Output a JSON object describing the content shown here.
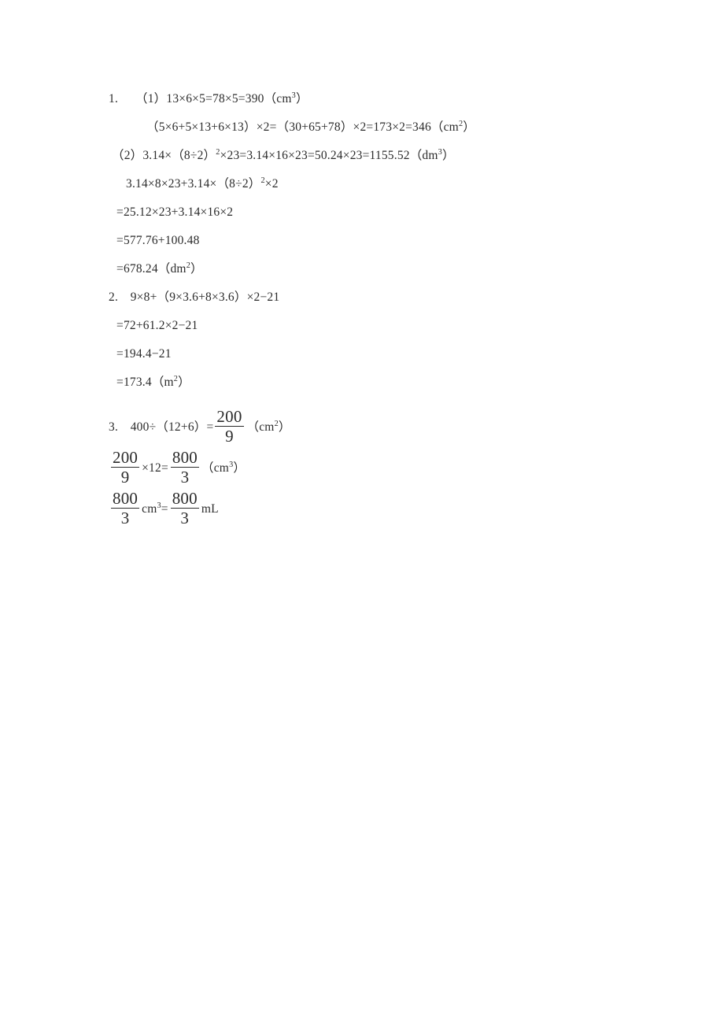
{
  "document": {
    "type": "math-answer-key",
    "text_color": "#2b2b2b",
    "background_color": "#ffffff"
  },
  "problems": [
    {
      "number": "1.",
      "lines": [
        {
          "id": "p1l1",
          "indent": "ind-0",
          "pre": "1.",
          "text": "（1）13×6×5=78×5=390（cm",
          "sup": "3",
          "post": "）"
        },
        {
          "id": "p1l2",
          "indent": "ind-4",
          "text": "（5×6+5×13+6×13）×2=（30+65+78）×2=173×2=346（cm",
          "sup": "2",
          "post": "）"
        },
        {
          "id": "p1l3",
          "indent": "ind-1",
          "text": "（2）3.14×（8÷2）",
          "sup": "2",
          "mid": "×23=3.14×16×23=50.24×23=1155.52（dm",
          "sup2": "3",
          "post": "）"
        },
        {
          "id": "p1l4",
          "indent": "ind-3",
          "text": "3.14×8×23+3.14×（8÷2）",
          "sup": "2",
          "post": "×2"
        },
        {
          "id": "p1l5",
          "indent": "ind-2",
          "text": "=25.12×23+3.14×16×2"
        },
        {
          "id": "p1l6",
          "indent": "ind-2",
          "text": "=577.76+100.48"
        },
        {
          "id": "p1l7",
          "indent": "ind-2",
          "text": "=678.24（dm",
          "sup": "2",
          "post": "）"
        }
      ]
    },
    {
      "number": "2.",
      "lines": [
        {
          "id": "p2l1",
          "indent": "ind-0",
          "text": "2.　9×8+（9×3.6+8×3.6）×2−21"
        },
        {
          "id": "p2l2",
          "indent": "ind-2",
          "text": "=72+61.2×2−21"
        },
        {
          "id": "p2l3",
          "indent": "ind-2",
          "text": "=194.4−21"
        },
        {
          "id": "p2l4",
          "indent": "ind-2",
          "text": "=173.4（m",
          "sup": "2",
          "post": "）"
        }
      ]
    },
    {
      "number": "3.",
      "head": {
        "id": "p3l1",
        "lead": "3.　400÷（12+6）=",
        "frac": {
          "num": "200",
          "den": "9"
        },
        "tail": "（cm",
        "sup": "2",
        "post": "）"
      },
      "fraction_lines": [
        {
          "id": "p3l2",
          "frac1": {
            "num": "200",
            "den": "9"
          },
          "mid": "×12=",
          "frac2": {
            "num": "800",
            "den": "3"
          },
          "tail": "（cm",
          "sup": "3",
          "post": "）"
        },
        {
          "id": "p3l3",
          "frac1": {
            "num": "800",
            "den": "3"
          },
          "mid_unit": "cm",
          "mid_sup": "3",
          "mid_eq": "=",
          "frac2": {
            "num": "800",
            "den": "3"
          },
          "tail_unit": "mL"
        }
      ]
    }
  ]
}
